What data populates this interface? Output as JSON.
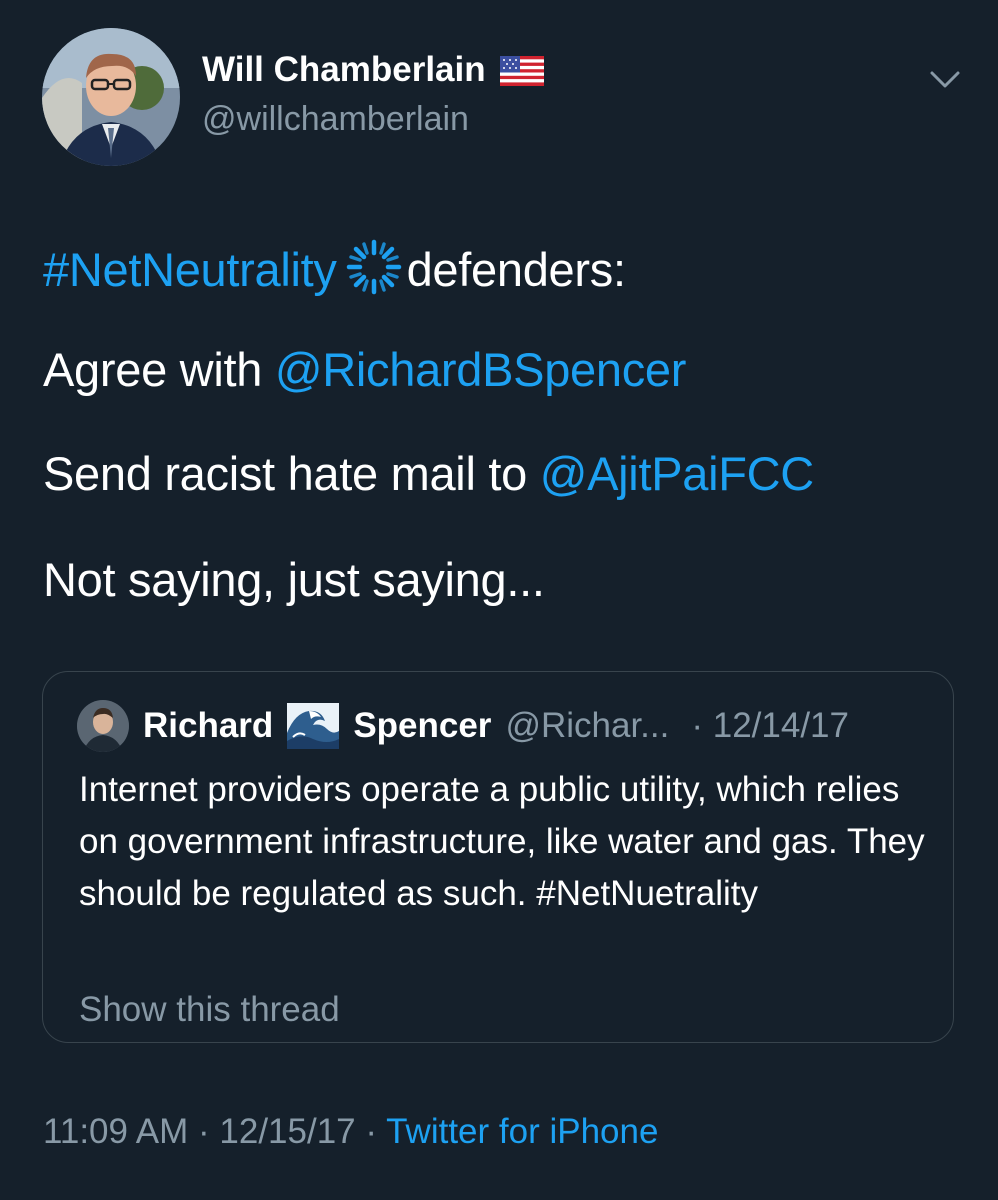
{
  "author": {
    "name": "Will Chamberlain",
    "handle": "@willchamberlain",
    "flag_icon": "us-flag-icon"
  },
  "tweet": {
    "line1": {
      "hashtag": "#NetNeutrality",
      "text": "defenders:"
    },
    "line2": {
      "text": "Agree with ",
      "mention": "@RichardBSpencer"
    },
    "line3": {
      "text": "Send racist hate mail to ",
      "mention": "@AjitPaiFCC"
    },
    "line4": {
      "text": "Not saying, just saying..."
    }
  },
  "quote": {
    "name_first": "Richard",
    "name_last": "Spencer",
    "handle": "@Richar...",
    "date": "· 12/14/17",
    "text": "Internet providers operate a public utility, which relies on government infrastructure, like water and gas. They should be regulated as such. #NetNuetrality",
    "show_thread": "Show this thread"
  },
  "meta": {
    "time_date": "11:09 AM · 12/15/17 · ",
    "source": "Twitter for iPhone"
  },
  "colors": {
    "background": "#15202b",
    "link": "#1da1f2",
    "secondary_text": "#8899a6",
    "border": "#38444d"
  }
}
